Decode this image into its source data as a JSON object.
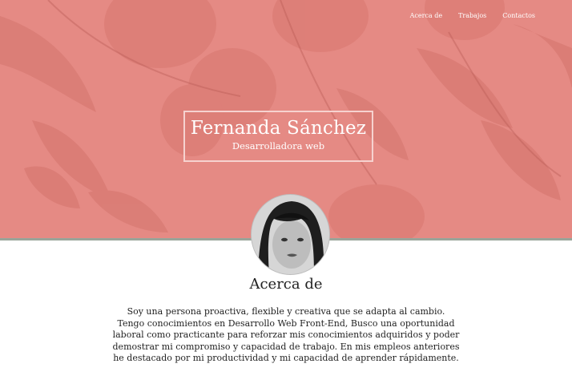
{
  "nav": {
    "items": [
      "Acerca de",
      "Trabajos",
      "Contactos"
    ]
  },
  "hero": {
    "name": "Fernanda Sánchez",
    "role": "Desarrolladora web"
  },
  "about": {
    "title": "Acerca de",
    "text": "Soy una persona proactiva, flexible y creativa que se adapta al cambio. Tengo conocimientos en Desarrollo Web Front-End, Busco una oportunidad laboral como practicante para reforzar mis conocimientos adquiridos y poder demostrar mi compromiso y capacidad de trabajo. En mis empleos anteriores he destacado por mi productividad y mi capacidad de aprender rápidamente."
  },
  "colors": {
    "hero_bg": "#e58a84",
    "accent_border": "#9aa59a"
  }
}
